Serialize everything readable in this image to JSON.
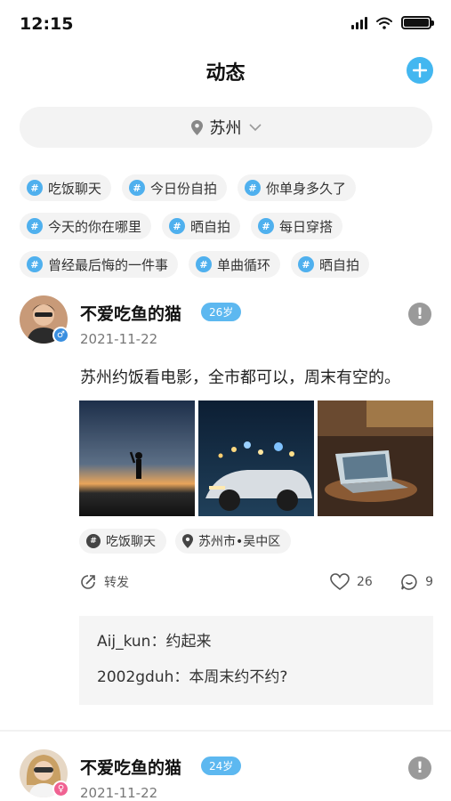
{
  "status_bar": {
    "time": "12:15"
  },
  "header": {
    "title": "动态"
  },
  "city_selector": {
    "city": "苏州"
  },
  "topics": [
    [
      "吃饭聊天",
      "今日份自拍",
      "你单身多久了"
    ],
    [
      "今天的你在哪里",
      "晒自拍",
      "每日穿搭"
    ],
    [
      "曾经最后悔的一件事",
      "单曲循环",
      "晒自拍"
    ]
  ],
  "posts": [
    {
      "username": "不爱吃鱼的猫",
      "age": "26岁",
      "date": "2021-11-22",
      "gender": "male",
      "text": "苏州约饭看电影，全市都可以，周末有空的。",
      "tags": {
        "topic": "吃饭聊天",
        "location": "苏州市•吴中区"
      },
      "share_label": "转发",
      "likes": "26",
      "comment_count": "9",
      "comments": [
        {
          "author": "Aij_kun",
          "sep": "：",
          "text": "约起来"
        },
        {
          "author": "2002gduh",
          "sep": "：",
          "text": "本周末约不约?"
        }
      ]
    },
    {
      "username": "不爱吃鱼的猫",
      "age": "24岁",
      "date": "2021-11-22",
      "gender": "female"
    }
  ],
  "colors": {
    "accent": "#43b7f0",
    "badge": "#5db8f0",
    "chip_bg": "#f3f3f3",
    "male": "#3a8fe0",
    "female": "#f06292"
  }
}
